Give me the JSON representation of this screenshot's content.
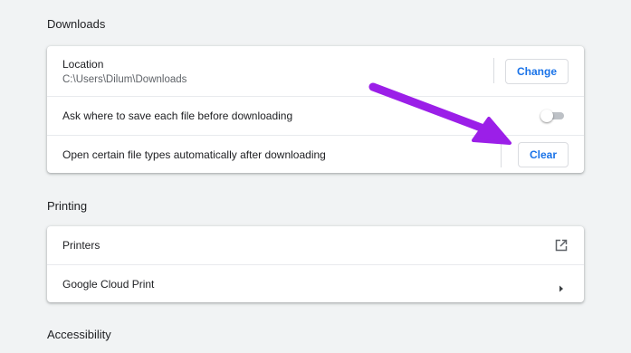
{
  "downloads": {
    "title": "Downloads",
    "location_label": "Location",
    "location_value": "C:\\Users\\Dilum\\Downloads",
    "change_label": "Change",
    "ask_label": "Ask where to save each file before downloading",
    "ask_enabled": false,
    "open_label": "Open certain file types automatically after downloading",
    "clear_label": "Clear"
  },
  "printing": {
    "title": "Printing",
    "printers_label": "Printers",
    "printers_icon": "open-in-new-icon",
    "cloud_label": "Google Cloud Print",
    "cloud_icon": "chevron-right-icon"
  },
  "accessibility": {
    "title": "Accessibility"
  },
  "annotation": {
    "arrow_color": "#9b1fe8"
  },
  "colors": {
    "page_bg": "#f1f3f4",
    "card_bg": "#ffffff",
    "accent": "#1a73e8"
  }
}
